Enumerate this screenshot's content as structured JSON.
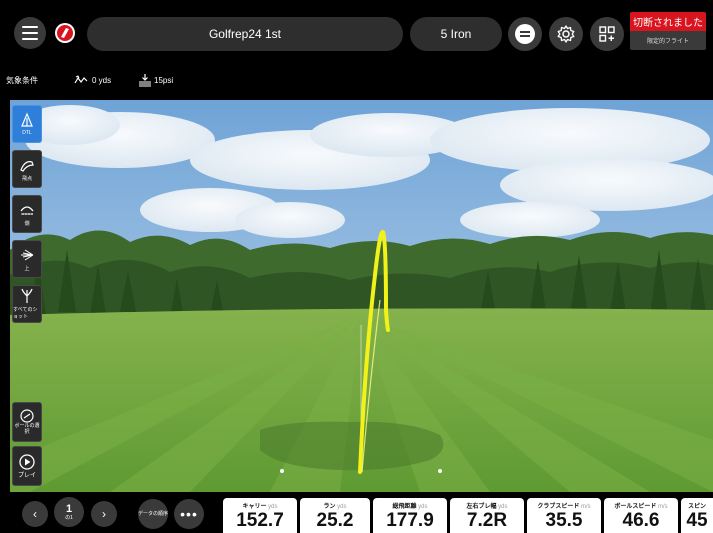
{
  "header": {
    "session_title": "Golfrep24 1st",
    "club": "5 Iron",
    "status_text": "切断されました",
    "status_sub": "限定的フライト"
  },
  "weather": {
    "label": "気象条件",
    "wind": "0 yds",
    "pressure": "15psi"
  },
  "views": [
    {
      "label": "DTL",
      "icon": "dtl-view-icon",
      "active": true
    },
    {
      "label": "飛点",
      "icon": "landing-view-icon",
      "active": false
    },
    {
      "label": "側",
      "icon": "side-view-icon",
      "active": false
    },
    {
      "label": "上",
      "icon": "top-view-icon",
      "active": false
    },
    {
      "label": "すべてのショット",
      "icon": "all-shots-icon",
      "active": false
    }
  ],
  "ball_select_label": "ボールの選択",
  "play_label": "プレイ",
  "shot_nav": {
    "number": "1",
    "of_label": "の1",
    "order_label": "データの順序"
  },
  "metrics": [
    {
      "label": "キャリー",
      "unit": "yds",
      "value": "152.7"
    },
    {
      "label": "ラン",
      "unit": "yds",
      "value": "25.2"
    },
    {
      "label": "総飛距離",
      "unit": "yds",
      "value": "177.9"
    },
    {
      "label": "左右ブレ幅",
      "unit": "yds",
      "value": "7.2R"
    },
    {
      "label": "クラブスピード",
      "unit": "m/s",
      "value": "35.5"
    },
    {
      "label": "ボールスピード",
      "unit": "m/s",
      "value": "46.6"
    },
    {
      "label": "スピン",
      "unit": "",
      "value": "45"
    }
  ],
  "colors": {
    "accent": "#2e7fd9",
    "status_red": "#d8141f",
    "trace": "#f2f21a",
    "grass": "#6fa43c",
    "sky": "#7fb0de"
  }
}
